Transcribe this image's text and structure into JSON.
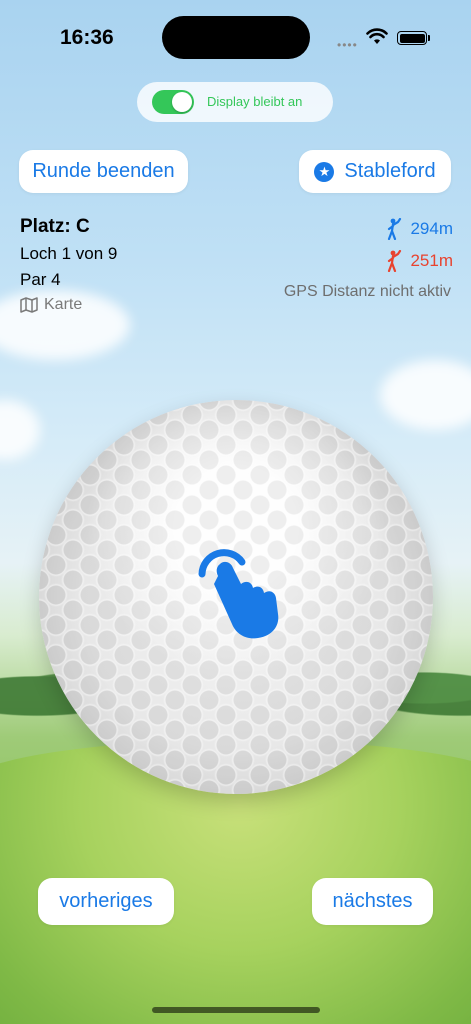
{
  "status_bar": {
    "time": "16:36",
    "signal_icon": "signal-dots-icon",
    "wifi_icon": "wifi-icon",
    "battery_icon": "battery-full-icon"
  },
  "display_toggle": {
    "label": "Display bleibt an",
    "on": true,
    "color": "#34c759"
  },
  "header_buttons": {
    "end_round": "Runde beenden",
    "stableford": "Stableford",
    "stableford_icon": "star-circle-icon"
  },
  "course_info": {
    "course": "Platz: C",
    "hole": "Loch 1 von 9",
    "par": "Par 4",
    "map_label": "Karte",
    "map_icon": "map-icon"
  },
  "distances": {
    "blue_value": "294m",
    "blue_icon": "golfer-blue-icon",
    "blue_color": "#1a7ae6",
    "red_value": "251m",
    "red_icon": "golfer-red-icon",
    "red_color": "#e8432f",
    "gps_status": "GPS Distanz nicht aktiv"
  },
  "ball": {
    "icon": "tap-hand-icon"
  },
  "navigation": {
    "previous": "vorheriges",
    "next": "nächstes"
  },
  "colors": {
    "accent": "#1a7ae6"
  }
}
